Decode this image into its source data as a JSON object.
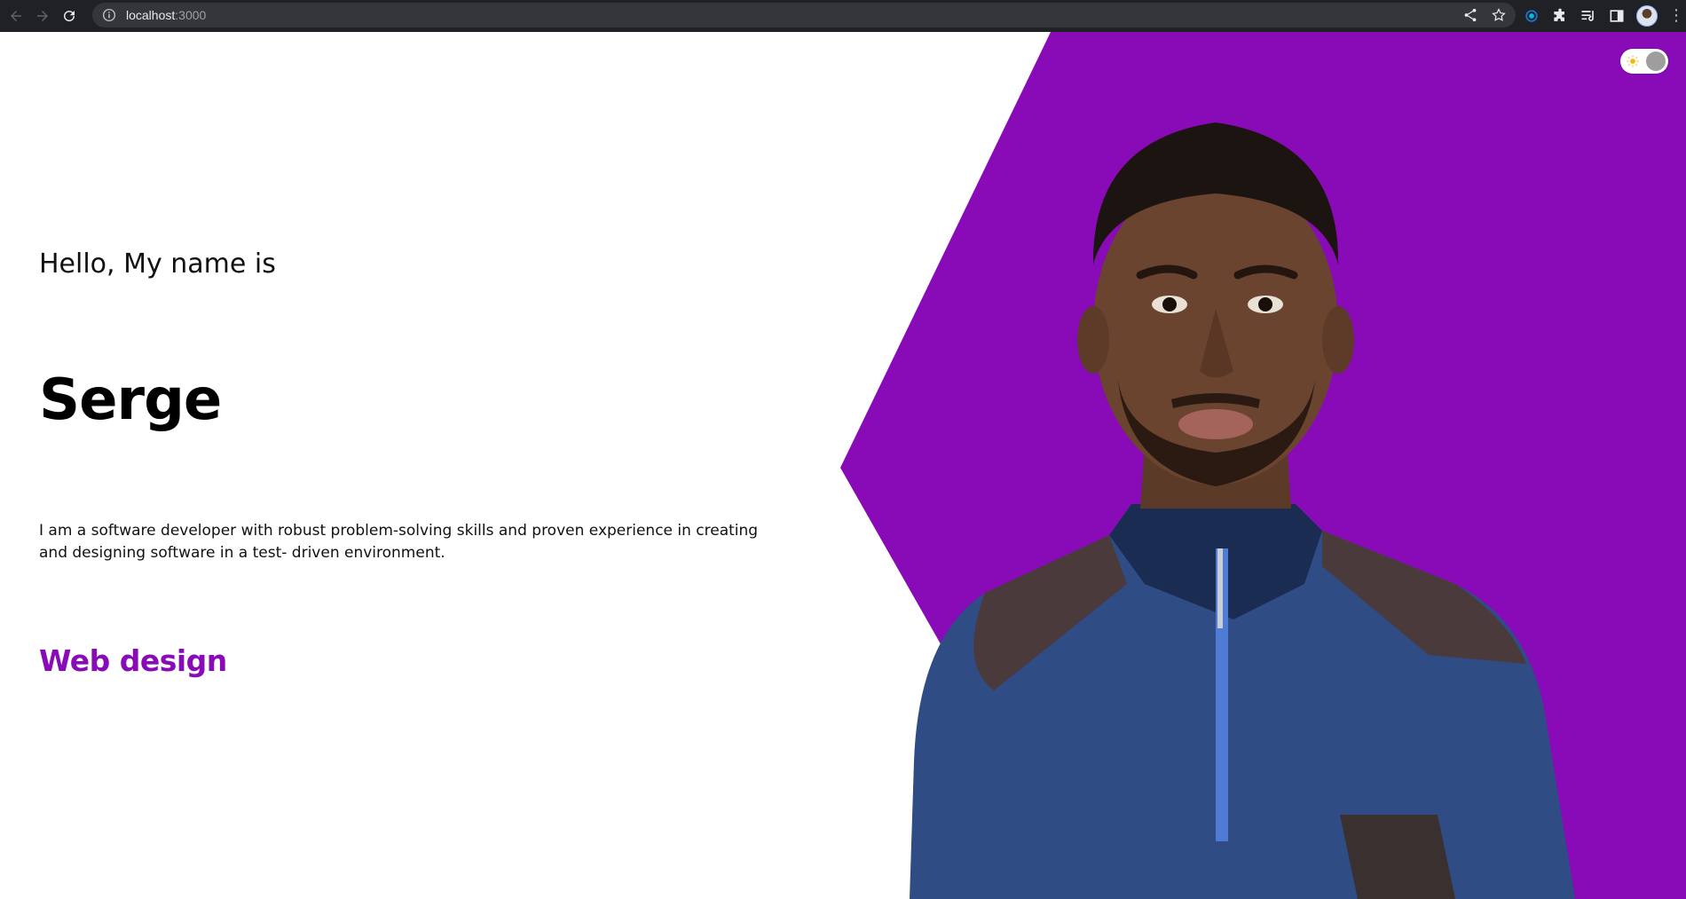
{
  "browser": {
    "url_host": "localhost",
    "url_port": ":3000",
    "icons": [
      "back-icon",
      "forward-icon",
      "reload-icon",
      "info-icon",
      "share-icon",
      "bookmark-star-icon",
      "extension-icon",
      "puzzle-icon",
      "reading-list-icon",
      "side-panel-icon",
      "profile-avatar",
      "more-menu-icon"
    ]
  },
  "hero": {
    "greeting": "Hello, My name is",
    "name": "Serge",
    "bio": "I am a software developer with robust problem-solving skills and proven experience in creating and designing software in a test- driven environment.",
    "role": "Web design"
  },
  "theme_toggle": {
    "icon": "sun-icon",
    "state": "light"
  },
  "colors": {
    "accent": "#880bb7",
    "chrome": "#202124",
    "omnibox": "#35363a"
  }
}
